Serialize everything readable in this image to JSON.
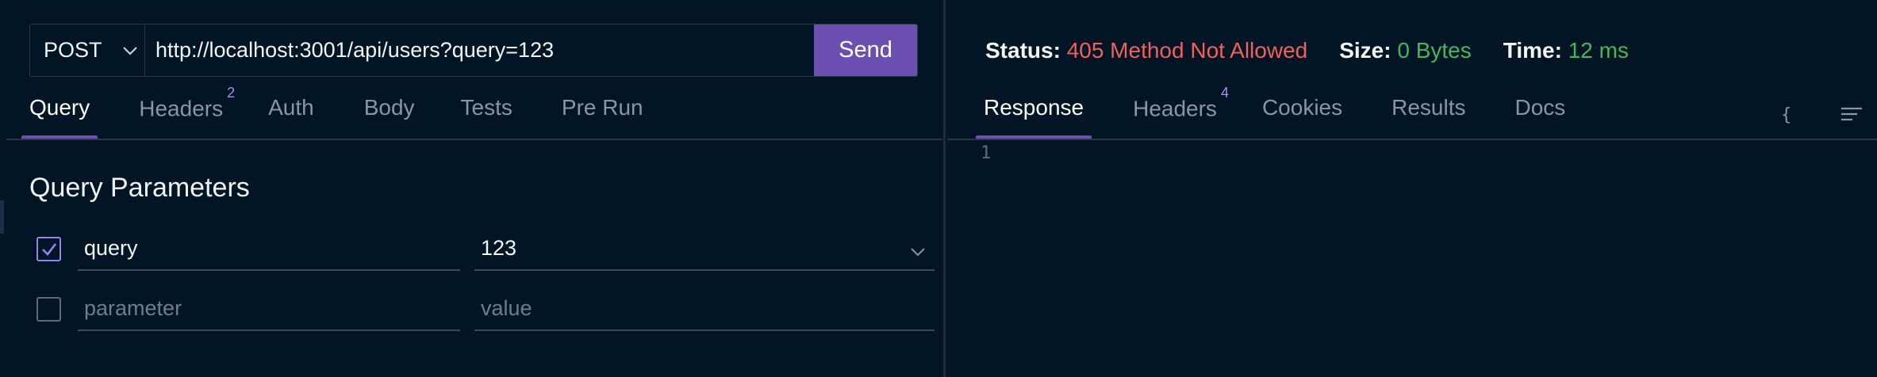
{
  "request": {
    "method": "POST",
    "url": "http://localhost:3001/api/users?query=123",
    "send_label": "Send"
  },
  "request_tabs": [
    {
      "label": "Query",
      "badge": "",
      "active": true
    },
    {
      "label": "Headers",
      "badge": "2",
      "active": false
    },
    {
      "label": "Auth",
      "badge": "",
      "active": false
    },
    {
      "label": "Body",
      "badge": "",
      "active": false
    },
    {
      "label": "Tests",
      "badge": "",
      "active": false
    },
    {
      "label": "Pre Run",
      "badge": "",
      "active": false
    }
  ],
  "query_section": {
    "title": "Query Parameters",
    "params": [
      {
        "checked": true,
        "key": "query",
        "value": "123"
      }
    ],
    "empty_row": {
      "key_placeholder": "parameter",
      "value_placeholder": "value"
    }
  },
  "response": {
    "status_label": "Status:",
    "status_value": "405 Method Not Allowed",
    "size_label": "Size:",
    "size_value": "0 Bytes",
    "time_label": "Time:",
    "time_value": "12 ms",
    "line_number": "1"
  },
  "response_tabs": [
    {
      "label": "Response",
      "badge": "",
      "active": true
    },
    {
      "label": "Headers",
      "badge": "4",
      "active": false
    },
    {
      "label": "Cookies",
      "badge": "",
      "active": false
    },
    {
      "label": "Results",
      "badge": "",
      "active": false
    },
    {
      "label": "Docs",
      "badge": "",
      "active": false
    }
  ],
  "icons": {
    "method_dropdown": "chevron-down-icon",
    "value_dropdown": "chevron-down-icon",
    "format_json": "braces-icon",
    "wrap_lines": "menu-lines-icon"
  },
  "colors": {
    "background": "#021524",
    "accent": "#6b4fb3",
    "status_error": "#f06060",
    "status_ok": "#42b85c",
    "badge": "#a98ef0"
  }
}
